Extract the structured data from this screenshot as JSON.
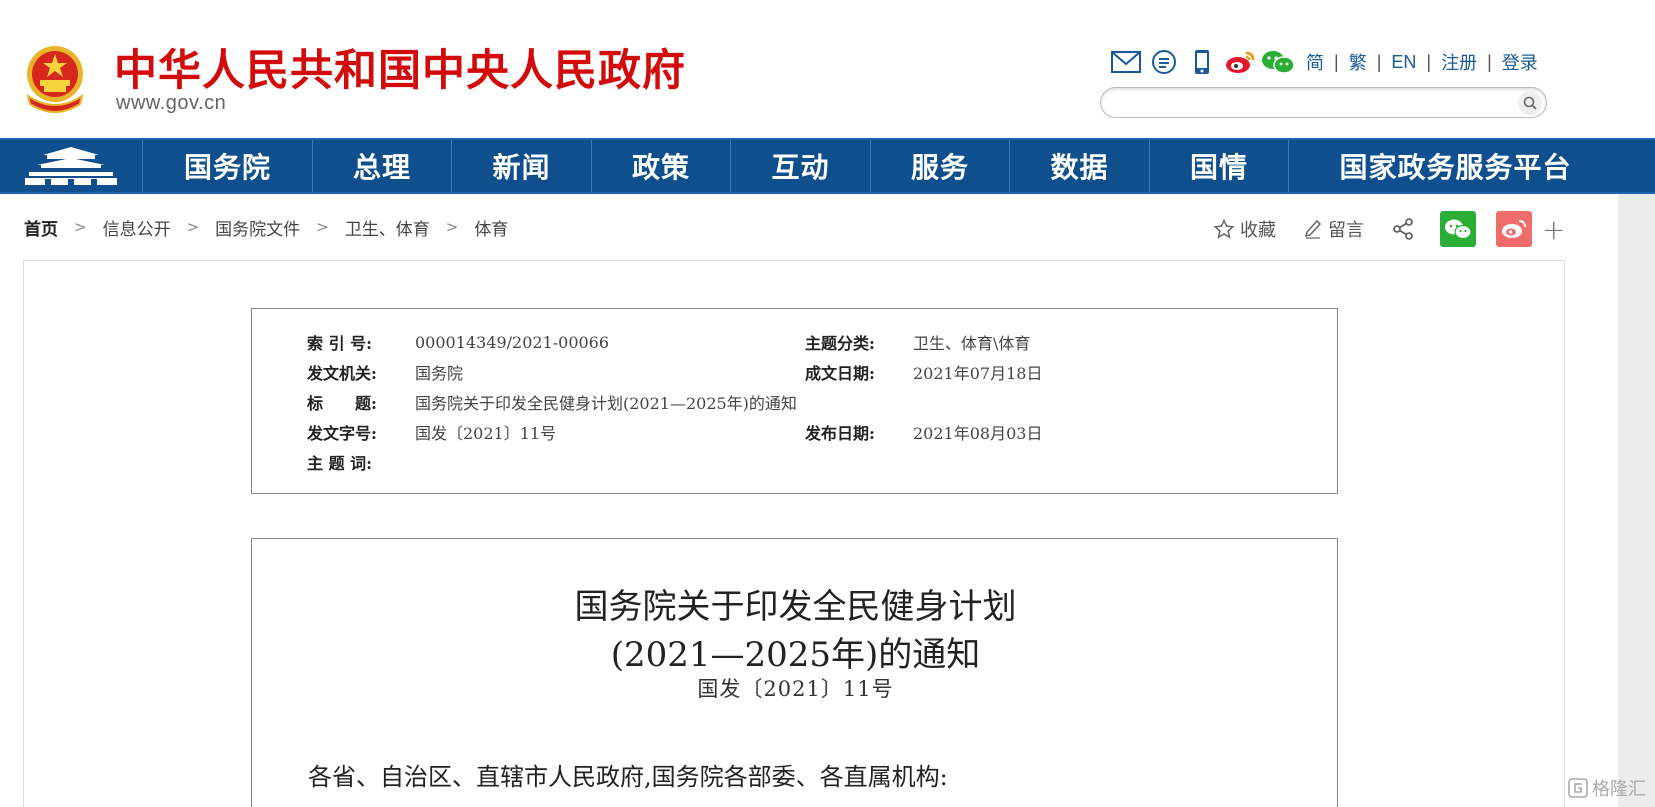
{
  "header": {
    "site_title": "中华人民共和国中央人民政府",
    "site_domain": "www.gov.cn",
    "tools": [
      "mail-icon",
      "message-icon",
      "mobile-icon",
      "weibo-icon",
      "wechat-icon"
    ],
    "lang_links": [
      "简",
      "繁",
      "EN",
      "注册",
      "登录"
    ],
    "search_placeholder": ""
  },
  "nav": {
    "items": [
      "国务院",
      "总理",
      "新闻",
      "政策",
      "互动",
      "服务",
      "数据",
      "国情",
      "国家政务服务平台"
    ]
  },
  "breadcrumb": {
    "items": [
      "首页",
      "信息公开",
      "国务院文件",
      "卫生、体育",
      "体育"
    ]
  },
  "actions": {
    "favorite_label": "收藏",
    "comment_label": "留言",
    "plus_label": "+"
  },
  "info": {
    "index_label": "索 引 号:",
    "index_value": "000014349/2021-00066",
    "topic_label": "主题分类:",
    "topic_value": "卫生、体育\\体育",
    "issuer_label": "发文机关:",
    "issuer_value": "国务院",
    "written_label": "成文日期:",
    "written_value": "2021年07月18日",
    "title_label": "标　　题:",
    "title_value": "国务院关于印发全民健身计划(2021—2025年)的通知",
    "docno_label": "发文字号:",
    "docno_value": "国发〔2021〕11号",
    "published_label": "发布日期:",
    "published_value": "2021年08月03日",
    "keywords_label": "主 题 词:",
    "keywords_value": ""
  },
  "document": {
    "title_line1": "国务院关于印发全民健身计划",
    "title_line2": "(2021—2025年)的通知",
    "doc_number": "国发〔2021〕11号",
    "greeting": "各省、自治区、直辖市人民政府,国务院各部委、各直属机构:"
  },
  "watermark": "格隆汇",
  "colors": {
    "title_red": "#d20a0a",
    "nav_blue": "#0f4f8e",
    "link_blue": "#1a5a9a",
    "wechat_green": "#2aae36",
    "weibo_red": "#f06b6b"
  }
}
